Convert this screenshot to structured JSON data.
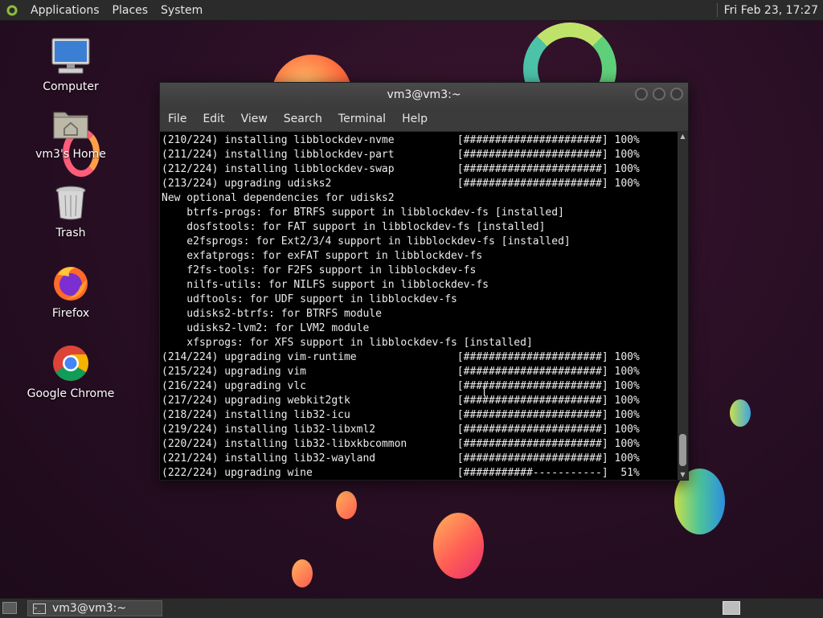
{
  "top_panel": {
    "menu": [
      "Applications",
      "Places",
      "System"
    ],
    "clock": "Fri Feb 23, 17:27"
  },
  "desktop_icons": [
    {
      "label": "Computer",
      "icon": "computer-icon"
    },
    {
      "label": "vm3's Home",
      "icon": "home-folder-icon"
    },
    {
      "label": "Trash",
      "icon": "trash-icon"
    },
    {
      "label": "Firefox",
      "icon": "firefox-icon"
    },
    {
      "label": "Google Chrome",
      "icon": "chrome-icon"
    }
  ],
  "terminal": {
    "title": "vm3@vm3:~",
    "menu": [
      "File",
      "Edit",
      "View",
      "Search",
      "Terminal",
      "Help"
    ],
    "lines": [
      "(210/224) installing libblockdev-nvme          [######################] 100%",
      "(211/224) installing libblockdev-part          [######################] 100%",
      "(212/224) installing libblockdev-swap          [######################] 100%",
      "(213/224) upgrading udisks2                    [######################] 100%",
      "New optional dependencies for udisks2",
      "    btrfs-progs: for BTRFS support in libblockdev-fs [installed]",
      "    dosfstools: for FAT support in libblockdev-fs [installed]",
      "    e2fsprogs: for Ext2/3/4 support in libblockdev-fs [installed]",
      "    exfatprogs: for exFAT support in libblockdev-fs",
      "    f2fs-tools: for F2FS support in libblockdev-fs",
      "    nilfs-utils: for NILFS support in libblockdev-fs",
      "    udftools: for UDF support in libblockdev-fs",
      "    udisks2-btrfs: for BTRFS module",
      "    udisks2-lvm2: for LVM2 module",
      "    xfsprogs: for XFS support in libblockdev-fs [installed]",
      "(214/224) upgrading vim-runtime                [######################] 100%",
      "(215/224) upgrading vim                        [######################] 100%",
      "(216/224) upgrading vlc                        [######################] 100%",
      "(217/224) upgrading webkit2gtk                 [######################] 100%",
      "(218/224) installing lib32-icu                 [######################] 100%",
      "(219/224) installing lib32-libxml2             [######################] 100%",
      "(220/224) installing lib32-libxkbcommon        [######################] 100%",
      "(221/224) installing lib32-wayland             [######################] 100%",
      "(222/224) upgrading wine                       [###########-----------]  51%"
    ]
  },
  "taskbar": {
    "task_label": "vm3@vm3:~"
  }
}
